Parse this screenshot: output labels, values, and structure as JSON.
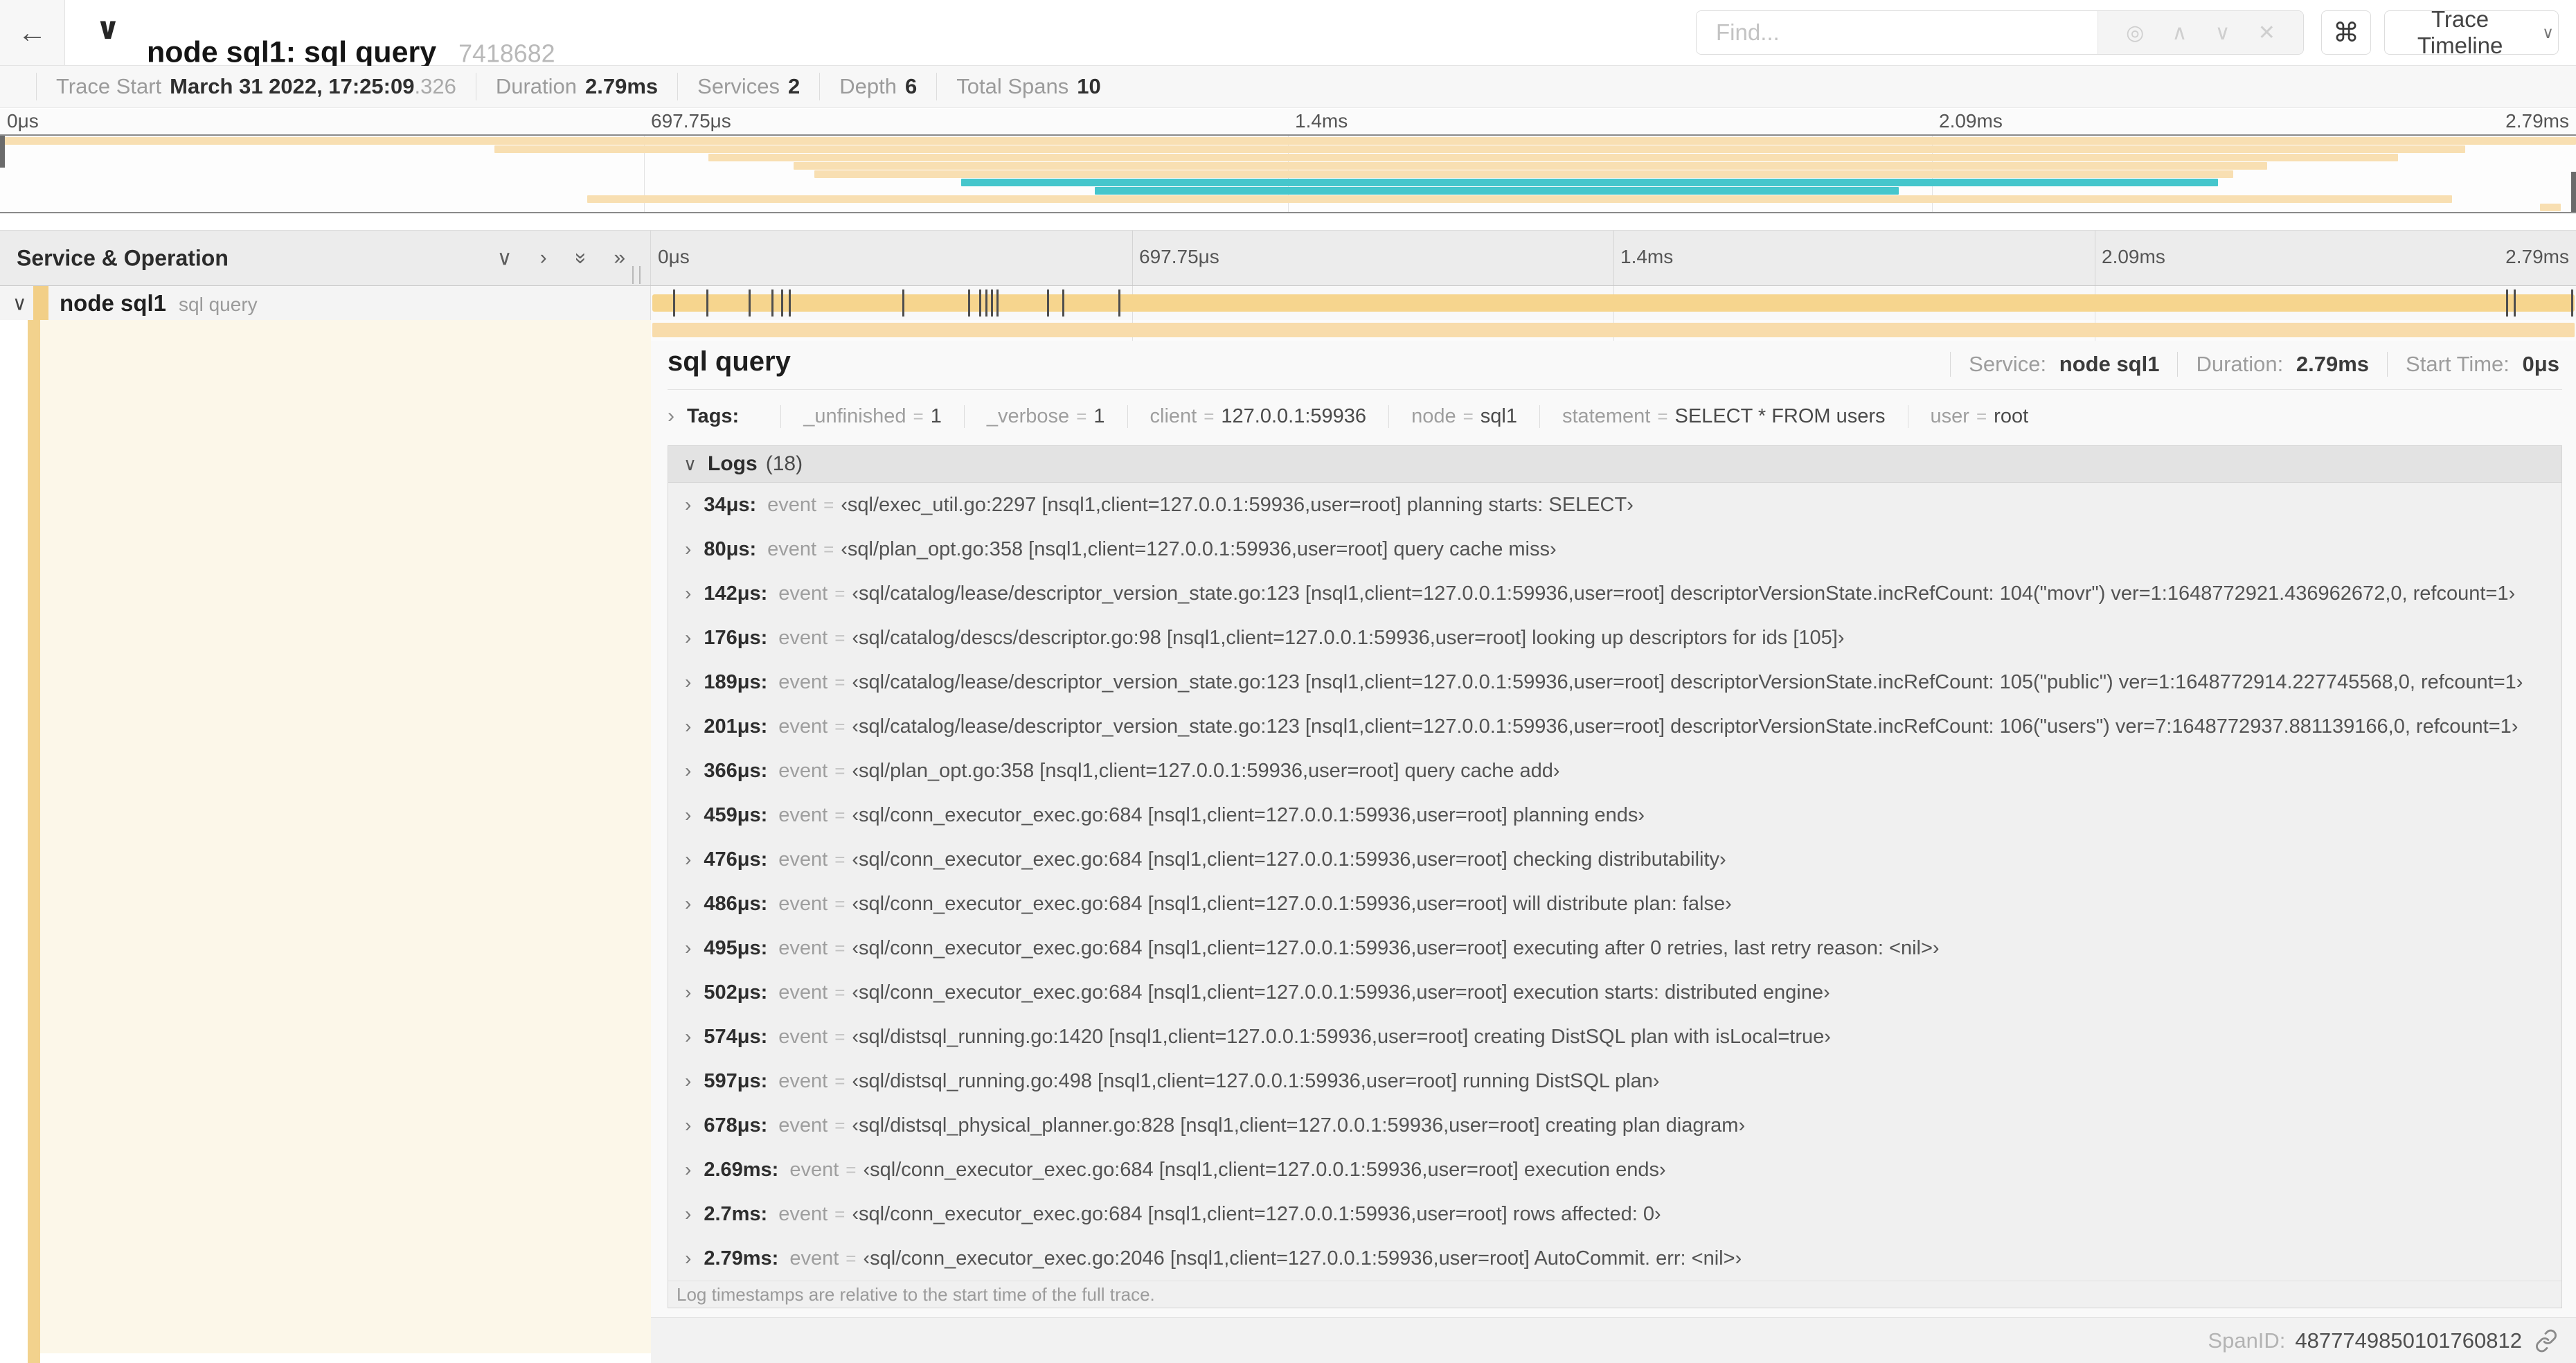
{
  "glyphs": {
    "back": "←",
    "collapse": "∨",
    "chevron_down": "∨",
    "chevron_right": "›",
    "double_chevron": "»",
    "up": "∧",
    "down": "∨",
    "close": "✕",
    "locate": "◎",
    "cmd": "⌘",
    "eq": "="
  },
  "colors": {
    "tan": "#f8dfb2",
    "teal": "#45c6cc",
    "span_bar": "#f6d58e",
    "stripe": "#f2d28d",
    "cream": "#fcf7e9"
  },
  "header": {
    "title": "node sql1: sql query",
    "trace_id": "7418682",
    "find_placeholder": "Find...",
    "view_selector": "Trace Timeline"
  },
  "trace_info": {
    "items": [
      {
        "label": "Trace Start",
        "value": "March 31 2022, 17:25:09",
        "suffix": ".326"
      },
      {
        "label": "Duration",
        "value": "2.79ms"
      },
      {
        "label": "Services",
        "value": "2"
      },
      {
        "label": "Depth",
        "value": "6"
      },
      {
        "label": "Total Spans",
        "value": "10"
      }
    ]
  },
  "timeline_ticks": [
    {
      "label": "0μs",
      "pct": 0
    },
    {
      "label": "697.75μs",
      "pct": 25
    },
    {
      "label": "1.4ms",
      "pct": 50
    },
    {
      "label": "2.09ms",
      "pct": 75
    },
    {
      "label": "2.79ms",
      "pct": 100
    }
  ],
  "grid_pcts": [
    25,
    50,
    75
  ],
  "minimap": {
    "spans": [
      {
        "row": 0,
        "start": 0,
        "end": 100,
        "color": "tan"
      },
      {
        "row": 1,
        "start": 19.2,
        "end": 95.7,
        "color": "tan"
      },
      {
        "row": 2,
        "start": 27.5,
        "end": 93.1,
        "color": "tan"
      },
      {
        "row": 3,
        "start": 30.8,
        "end": 88.0,
        "color": "tan"
      },
      {
        "row": 4,
        "start": 31.6,
        "end": 86.7,
        "color": "tan"
      },
      {
        "row": 5,
        "start": 37.3,
        "end": 86.1,
        "color": "teal"
      },
      {
        "row": 6,
        "start": 42.5,
        "end": 73.7,
        "color": "teal"
      },
      {
        "row": 7,
        "start": 22.8,
        "end": 95.2,
        "color": "tan"
      },
      {
        "row": 8,
        "start": 98.6,
        "end": 99.4,
        "color": "tan"
      }
    ]
  },
  "timeline": {
    "left_header": "Service & Operation",
    "row": {
      "service": "node sql1",
      "operation": "sql query"
    },
    "marker_pcts": [
      1.2,
      2.9,
      5.1,
      6.3,
      6.8,
      7.2,
      13.1,
      16.5,
      17.1,
      17.4,
      17.7,
      18.0,
      20.6,
      21.4,
      24.3,
      96.4,
      96.8,
      99.8
    ]
  },
  "detail": {
    "title": "sql query",
    "meta": [
      {
        "label": "Service:",
        "value": "node sql1"
      },
      {
        "label": "Duration:",
        "value": "2.79ms"
      },
      {
        "label": "Start Time:",
        "value": "0μs"
      }
    ],
    "tags_label": "Tags:",
    "tags": [
      {
        "key": "_unfinished",
        "value": "1"
      },
      {
        "key": "_verbose",
        "value": "1"
      },
      {
        "key": "client",
        "value": "127.0.0.1:59936"
      },
      {
        "key": "node",
        "value": "sql1"
      },
      {
        "key": "statement",
        "value": "SELECT * FROM users"
      },
      {
        "key": "user",
        "value": "root"
      }
    ],
    "logs": {
      "label": "Logs",
      "count": "(18)",
      "entries": [
        {
          "time": "34μs:",
          "key": "event",
          "value": "‹sql/exec_util.go:2297 [nsql1,client=127.0.0.1:59936,user=root] planning starts: SELECT›"
        },
        {
          "time": "80μs:",
          "key": "event",
          "value": "‹sql/plan_opt.go:358 [nsql1,client=127.0.0.1:59936,user=root] query cache miss›"
        },
        {
          "time": "142μs:",
          "key": "event",
          "value": "‹sql/catalog/lease/descriptor_version_state.go:123 [nsql1,client=127.0.0.1:59936,user=root] descriptorVersionState.incRefCount: 104(\"movr\") ver=1:1648772921.436962672,0, refcount=1›"
        },
        {
          "time": "176μs:",
          "key": "event",
          "value": "‹sql/catalog/descs/descriptor.go:98 [nsql1,client=127.0.0.1:59936,user=root] looking up descriptors for ids [105]›"
        },
        {
          "time": "189μs:",
          "key": "event",
          "value": "‹sql/catalog/lease/descriptor_version_state.go:123 [nsql1,client=127.0.0.1:59936,user=root] descriptorVersionState.incRefCount: 105(\"public\") ver=1:1648772914.227745568,0, refcount=1›"
        },
        {
          "time": "201μs:",
          "key": "event",
          "value": "‹sql/catalog/lease/descriptor_version_state.go:123 [nsql1,client=127.0.0.1:59936,user=root] descriptorVersionState.incRefCount: 106(\"users\") ver=7:1648772937.881139166,0, refcount=1›"
        },
        {
          "time": "366μs:",
          "key": "event",
          "value": "‹sql/plan_opt.go:358 [nsql1,client=127.0.0.1:59936,user=root] query cache add›"
        },
        {
          "time": "459μs:",
          "key": "event",
          "value": "‹sql/conn_executor_exec.go:684 [nsql1,client=127.0.0.1:59936,user=root] planning ends›"
        },
        {
          "time": "476μs:",
          "key": "event",
          "value": "‹sql/conn_executor_exec.go:684 [nsql1,client=127.0.0.1:59936,user=root] checking distributability›"
        },
        {
          "time": "486μs:",
          "key": "event",
          "value": "‹sql/conn_executor_exec.go:684 [nsql1,client=127.0.0.1:59936,user=root] will distribute plan: false›"
        },
        {
          "time": "495μs:",
          "key": "event",
          "value": "‹sql/conn_executor_exec.go:684 [nsql1,client=127.0.0.1:59936,user=root] executing after 0 retries, last retry reason: <nil>›"
        },
        {
          "time": "502μs:",
          "key": "event",
          "value": "‹sql/conn_executor_exec.go:684 [nsql1,client=127.0.0.1:59936,user=root] execution starts: distributed engine›"
        },
        {
          "time": "574μs:",
          "key": "event",
          "value": "‹sql/distsql_running.go:1420 [nsql1,client=127.0.0.1:59936,user=root] creating DistSQL plan with isLocal=true›"
        },
        {
          "time": "597μs:",
          "key": "event",
          "value": "‹sql/distsql_running.go:498 [nsql1,client=127.0.0.1:59936,user=root] running DistSQL plan›"
        },
        {
          "time": "678μs:",
          "key": "event",
          "value": "‹sql/distsql_physical_planner.go:828 [nsql1,client=127.0.0.1:59936,user=root] creating plan diagram›"
        },
        {
          "time": "2.69ms:",
          "key": "event",
          "value": "‹sql/conn_executor_exec.go:684 [nsql1,client=127.0.0.1:59936,user=root] execution ends›"
        },
        {
          "time": "2.7ms:",
          "key": "event",
          "value": "‹sql/conn_executor_exec.go:684 [nsql1,client=127.0.0.1:59936,user=root] rows affected: 0›"
        },
        {
          "time": "2.79ms:",
          "key": "event",
          "value": "‹sql/conn_executor_exec.go:2046 [nsql1,client=127.0.0.1:59936,user=root] AutoCommit. err: <nil>›"
        }
      ],
      "note": "Log timestamps are relative to the start time of the full trace."
    },
    "footer": {
      "label": "SpanID:",
      "value": "4877749850101760812"
    }
  }
}
